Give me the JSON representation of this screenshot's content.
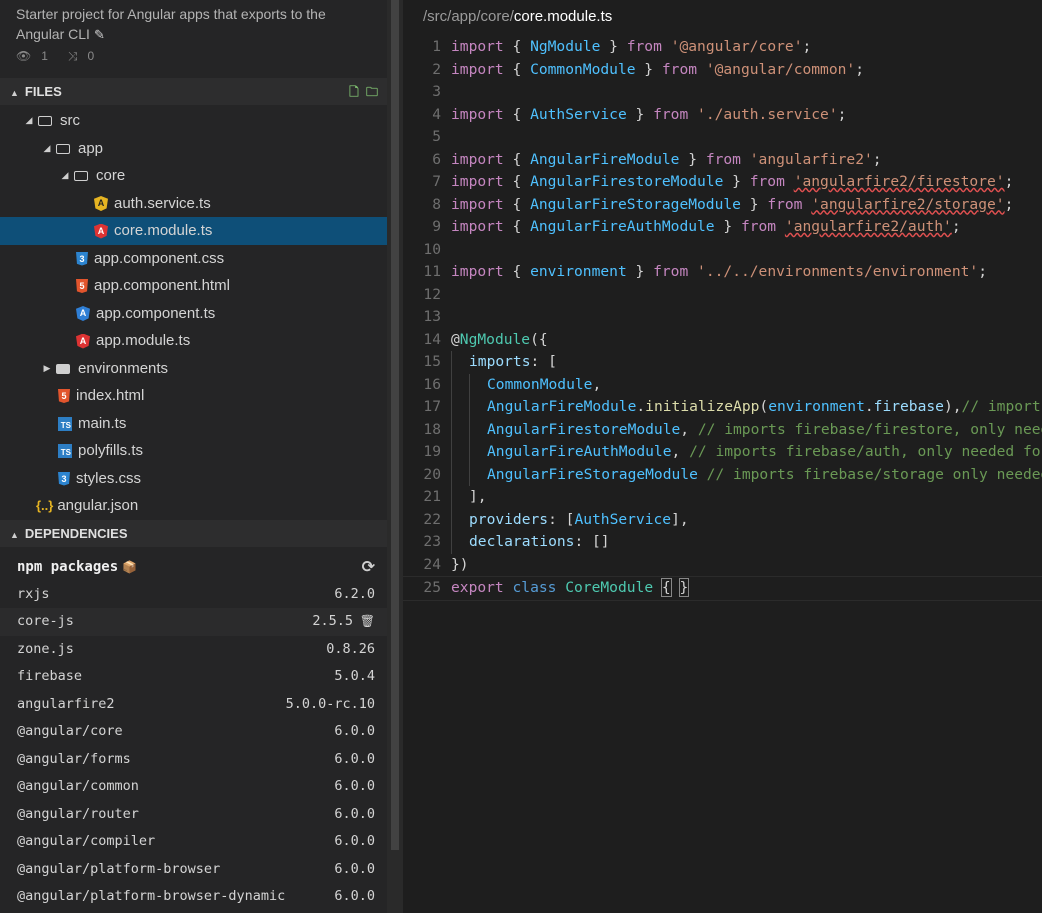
{
  "project": {
    "description": "Starter project for Angular apps that exports to the Angular CLI",
    "views": "1",
    "forks": "0"
  },
  "files_section": {
    "title": "FILES"
  },
  "tree": [
    {
      "label": "src"
    },
    {
      "label": "app"
    },
    {
      "label": "core"
    },
    {
      "label": "auth.service.ts"
    },
    {
      "label": "core.module.ts"
    },
    {
      "label": "app.component.css"
    },
    {
      "label": "app.component.html"
    },
    {
      "label": "app.component.ts"
    },
    {
      "label": "app.module.ts"
    },
    {
      "label": "environments"
    },
    {
      "label": "index.html"
    },
    {
      "label": "main.ts"
    },
    {
      "label": "polyfills.ts"
    },
    {
      "label": "styles.css"
    },
    {
      "label": "angular.json"
    }
  ],
  "deps_section": {
    "title": "DEPENDENCIES",
    "npm_label": "npm packages"
  },
  "deps": [
    {
      "name": "rxjs",
      "version": "6.2.0"
    },
    {
      "name": "core-js",
      "version": "2.5.5"
    },
    {
      "name": "zone.js",
      "version": "0.8.26"
    },
    {
      "name": "firebase",
      "version": "5.0.4"
    },
    {
      "name": "angularfire2",
      "version": "5.0.0-rc.10"
    },
    {
      "name": "@angular/core",
      "version": "6.0.0"
    },
    {
      "name": "@angular/forms",
      "version": "6.0.0"
    },
    {
      "name": "@angular/common",
      "version": "6.0.0"
    },
    {
      "name": "@angular/router",
      "version": "6.0.0"
    },
    {
      "name": "@angular/compiler",
      "version": "6.0.0"
    },
    {
      "name": "@angular/platform-browser",
      "version": "6.0.0"
    },
    {
      "name": "@angular/platform-browser-dynamic",
      "version": "6.0.0"
    }
  ],
  "editor": {
    "path_prefix": "/src/app/core/",
    "file_name": "core.module.ts"
  },
  "code_lines": [
    {
      "n": "1",
      "p": [
        "import",
        " { ",
        "NgModule",
        " } ",
        "from",
        " ",
        "'@angular/core'",
        ";"
      ]
    },
    {
      "n": "2",
      "p": [
        "import",
        " { ",
        "CommonModule",
        " } ",
        "from",
        " ",
        "'@angular/common'",
        ";"
      ]
    },
    {
      "n": "3",
      "p": []
    },
    {
      "n": "4",
      "p": [
        "import",
        " { ",
        "AuthService",
        " } ",
        "from",
        " ",
        "'./auth.service'",
        ";"
      ]
    },
    {
      "n": "5",
      "p": []
    },
    {
      "n": "6",
      "p": [
        "import",
        " { ",
        "AngularFireModule",
        " } ",
        "from",
        " ",
        "'angularfire2'",
        ";"
      ]
    },
    {
      "n": "7",
      "p": [
        "import",
        " { ",
        "AngularFirestoreModule",
        " } ",
        "from",
        " ",
        "'angularfire2/firestore'",
        ";"
      ]
    },
    {
      "n": "8",
      "p": [
        "import",
        " { ",
        "AngularFireStorageModule",
        " } ",
        "from",
        " ",
        "'angularfire2/storage'",
        ";"
      ]
    },
    {
      "n": "9",
      "p": [
        "import",
        " { ",
        "AngularFireAuthModule",
        " } ",
        "from",
        " ",
        "'angularfire2/auth'",
        ";"
      ]
    },
    {
      "n": "10",
      "p": []
    },
    {
      "n": "11",
      "p": [
        "import",
        " { ",
        "environment",
        " } ",
        "from",
        " ",
        "'../../environments/environment'",
        ";"
      ]
    },
    {
      "n": "12",
      "p": []
    },
    {
      "n": "13",
      "p": []
    },
    {
      "n": "14",
      "p": [
        "@",
        "NgModule",
        "({"
      ]
    },
    {
      "n": "15",
      "p": [
        "imports",
        ": ["
      ]
    },
    {
      "n": "16",
      "p": [
        "CommonModule",
        ","
      ]
    },
    {
      "n": "17",
      "p": [
        "AngularFireModule",
        ".",
        "initializeApp",
        "(",
        "environment",
        ".",
        "firebase",
        "),",
        "// imports firebase/app needed for everything"
      ]
    },
    {
      "n": "18",
      "p": [
        "AngularFirestoreModule",
        ", ",
        "// imports firebase/firestore, only needed for database features"
      ]
    },
    {
      "n": "19",
      "p": [
        "AngularFireAuthModule",
        ", ",
        "// imports firebase/auth, only needed for auth features"
      ]
    },
    {
      "n": "20",
      "p": [
        "AngularFireStorageModule",
        " ",
        "// imports firebase/storage only needed for storage features"
      ]
    },
    {
      "n": "21",
      "p": [
        "],"
      ]
    },
    {
      "n": "22",
      "p": [
        "providers",
        ": [",
        "AuthService",
        "],"
      ]
    },
    {
      "n": "23",
      "p": [
        "declarations",
        ": []"
      ]
    },
    {
      "n": "24",
      "p": [
        "})"
      ]
    },
    {
      "n": "25",
      "p": [
        "export",
        " ",
        "class",
        " ",
        "CoreModule",
        " ",
        "{",
        " ",
        "}"
      ]
    }
  ]
}
